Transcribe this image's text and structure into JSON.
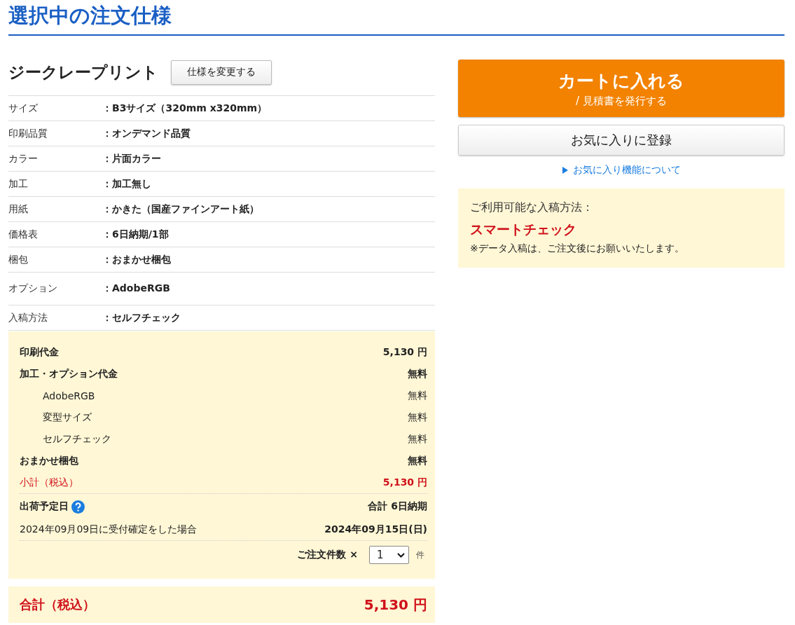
{
  "title": "選択中の注文仕様",
  "product": {
    "name": "ジークレープリント",
    "change_button": "仕様を変更する"
  },
  "specs": [
    {
      "label": "サイズ",
      "value": "：B3サイズ（320mm x320mm）"
    },
    {
      "label": "印刷品質",
      "value": "：オンデマンド品質"
    },
    {
      "label": "カラー",
      "value": "：片面カラー"
    },
    {
      "label": "加工",
      "value": "：加工無し"
    },
    {
      "label": "用紙",
      "value": "：かきた（国産ファインアート紙）"
    },
    {
      "label": "価格表",
      "value": "：6日納期/1部"
    },
    {
      "label": "梱包",
      "value": "：おまかせ梱包"
    },
    {
      "label": "オプション",
      "value": "：AdobeRGB",
      "kind": "tall"
    },
    {
      "label": "入稿方法",
      "value": "：セルフチェック"
    }
  ],
  "charges": [
    {
      "kind": "main",
      "label": "印刷代金",
      "amount": "5,130 円"
    },
    {
      "kind": "main",
      "label": "加工・オプション代金",
      "amount": "無料"
    },
    {
      "kind": "sub",
      "label": "AdobeRGB",
      "amount": "無料"
    },
    {
      "kind": "sub",
      "label": "変型サイズ",
      "amount": "無料"
    },
    {
      "kind": "sub",
      "label": "セルフチェック",
      "amount": "無料"
    },
    {
      "kind": "main",
      "label": "おまかせ梱包",
      "amount": "無料"
    },
    {
      "kind": "subtotal",
      "label": "小計（税込）",
      "amount": "5,130 円"
    }
  ],
  "shipping": {
    "label": "出荷予定日",
    "total": "合計 6日納期",
    "condition": "2024年09月09日に受付確定をした場合",
    "date": "2024年09月15日(日)"
  },
  "quantity": {
    "label": "ご注文件数 ×",
    "value": "1",
    "unit": "件"
  },
  "total": {
    "label": "合計（税込）",
    "amount": "5,130 円"
  },
  "cart_button": {
    "label": "カートに入れる",
    "sub": "/ 見積書を発行する"
  },
  "favorite_button": "お気に入りに登録",
  "favorite_link": "お気に入り機能について",
  "upload_info": {
    "heading": "ご利用可能な入稿方法：",
    "method": "スマートチェック",
    "note": "※データ入稿は、ご注文後にお願いいたします。"
  }
}
